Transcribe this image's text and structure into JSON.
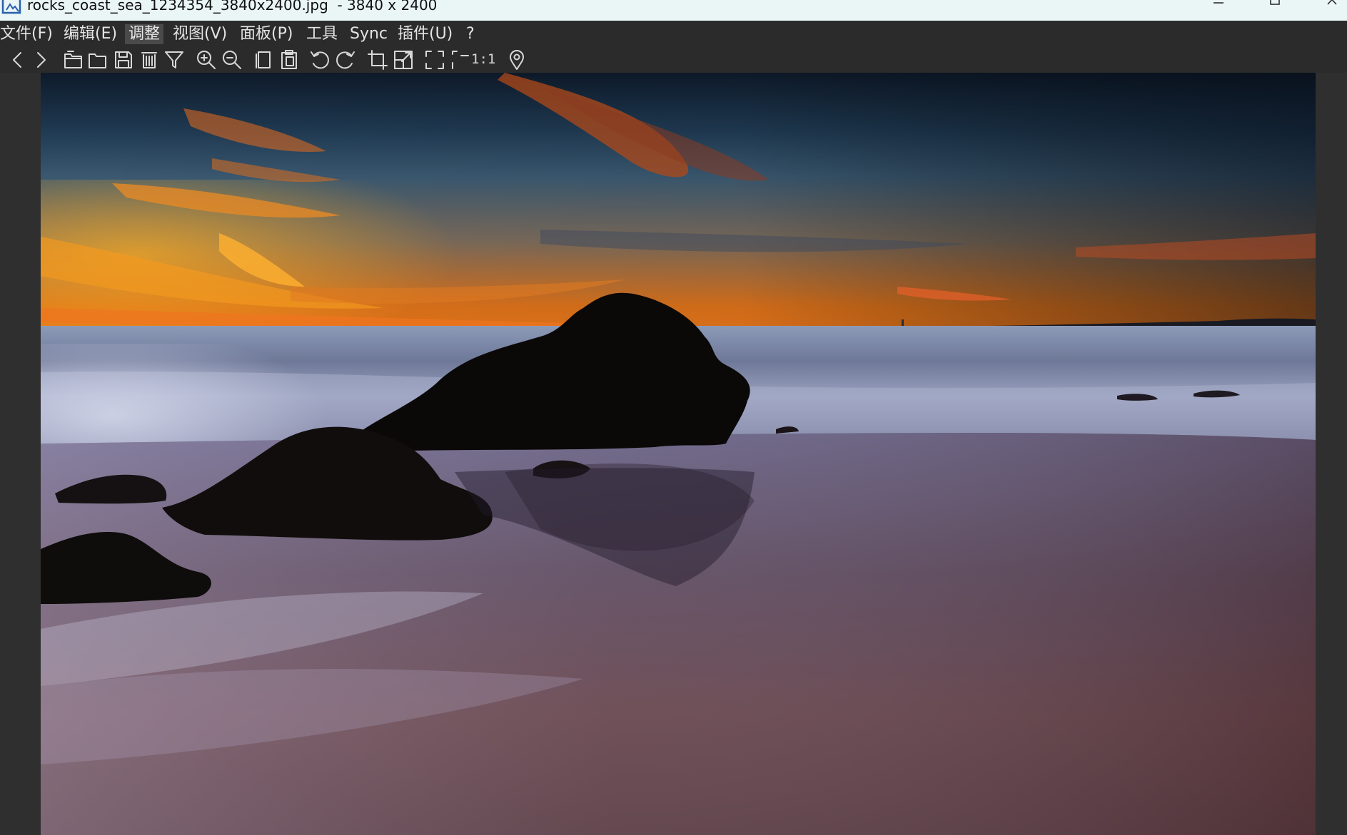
{
  "window": {
    "title": "rocks_coast_sea_1234354_3840x2400.jpg  - 3840 x 2400",
    "minimize_icon": "minimize-icon",
    "maximize_icon": "maximize-icon",
    "close_icon": "close-icon"
  },
  "menu": {
    "items": [
      {
        "label": "文件(F)"
      },
      {
        "label": "编辑(E)"
      },
      {
        "label": "调整"
      },
      {
        "label": "视图(V)"
      },
      {
        "label": "面板(P)"
      },
      {
        "label": "工具"
      },
      {
        "label": "Sync"
      },
      {
        "label": "插件(U)"
      },
      {
        "label": "?"
      }
    ],
    "active_item": "调整"
  },
  "toolbar": {
    "icons": [
      "previous-icon",
      "next-icon",
      "open-folder-icon",
      "browse-folder-icon",
      "save-icon",
      "delete-icon",
      "filter-icon",
      "zoom-in-icon",
      "zoom-out-icon",
      "copy-icon",
      "paste-icon",
      "rotate-left-icon",
      "rotate-right-icon",
      "crop-icon",
      "resize-icon",
      "fit-window-icon",
      "fit-width-icon",
      "location-pin-icon"
    ],
    "actual_size_label": "1:1"
  },
  "image": {
    "file_name": "rocks_coast_sea_1234354_3840x2400.jpg",
    "description_colors": {
      "sky_top": "#0f1d2d",
      "sunset_orange": "#f08a1a",
      "sea": "#7d8aa6",
      "sand": "#5a3d3e",
      "rock": "#0a0808"
    }
  },
  "colors": {
    "titlebar_bg": "#eaf6f6",
    "app_bg": "#2b2b2b",
    "menu_text": "#e4e4e4",
    "menu_active_bg": "#4a4a4a"
  }
}
